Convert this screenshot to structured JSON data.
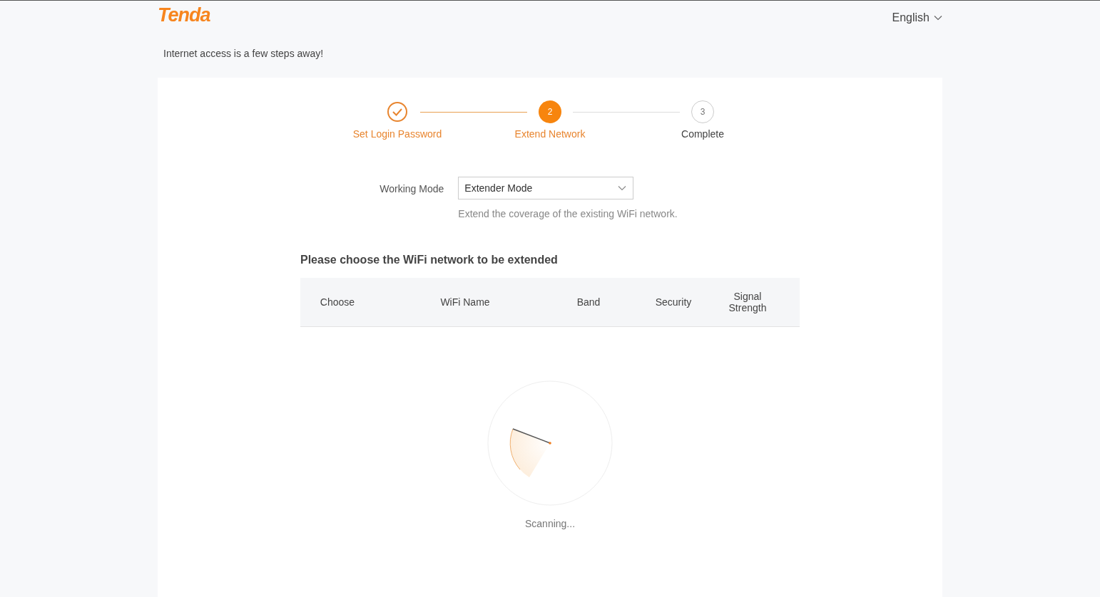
{
  "header": {
    "logo": "Tenda",
    "language": "English"
  },
  "tagline": "Internet access is a few steps away!",
  "steps": [
    {
      "kind": "done",
      "label": "Set Login Password"
    },
    {
      "kind": "active",
      "number": "2",
      "label": "Extend Network"
    },
    {
      "kind": "pending",
      "number": "3",
      "label": "Complete"
    }
  ],
  "working_mode": {
    "label": "Working Mode",
    "value": "Extender Mode",
    "hint": "Extend the coverage of the existing WiFi network."
  },
  "network_section": {
    "title": "Please choose the WiFi network to be extended",
    "columns": [
      "Choose",
      "WiFi Name",
      "Band",
      "Security",
      "Signal Strength"
    ],
    "scan_status": "Scanning..."
  }
}
